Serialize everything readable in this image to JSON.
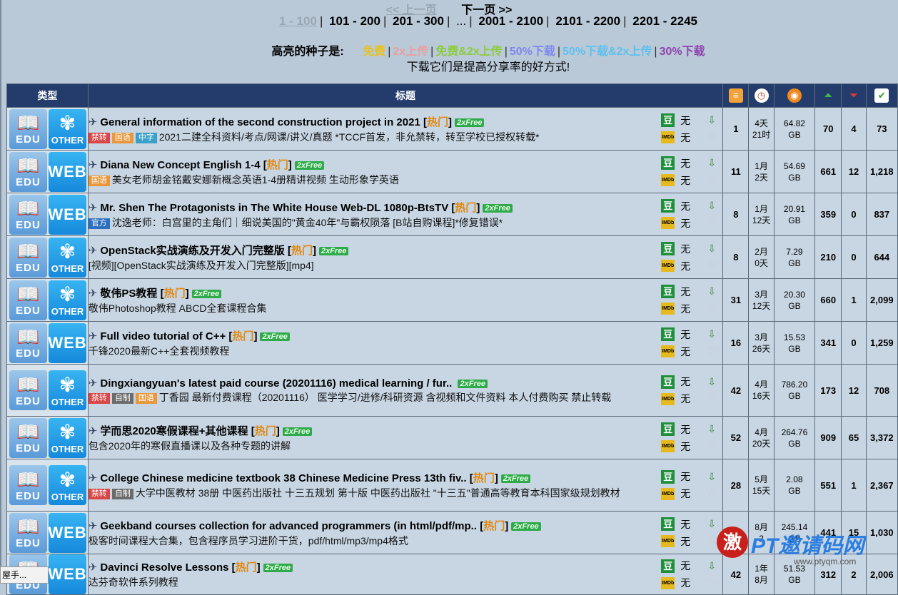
{
  "pager": {
    "prev": "<< 上一页",
    "next": "下一页 >>",
    "pages": [
      "1 - 100",
      "101 - 200",
      "201 - 300",
      "...",
      "2001 - 2100",
      "2101 - 2200",
      "2201 - 2245"
    ]
  },
  "legend": {
    "label": "高亮的种子是:",
    "items": [
      {
        "text": "免费",
        "color": "#e8c21a"
      },
      {
        "text": "2x上传",
        "color": "#e8a0a0"
      },
      {
        "text": "免费&2x上传",
        "color": "#8ccc3a"
      },
      {
        "text": "50%下载",
        "color": "#7f88ee"
      },
      {
        "text": "50%下载&2x上传",
        "color": "#5fc0ec"
      },
      {
        "text": "30%下载",
        "color": "#8e44ad"
      }
    ],
    "hint": "下载它们是提高分享率的好方式!"
  },
  "header": {
    "type": "类型",
    "title": "标题"
  },
  "rows": [
    {
      "cat": "OTHER",
      "title": "General information of the second construction project in 2021",
      "hot": "热门",
      "free": "2xFree",
      "tags": [
        {
          "t": "禁转",
          "c": "jz"
        },
        {
          "t": "国语",
          "c": "gy"
        },
        {
          "t": "中字",
          "c": "zw"
        }
      ],
      "sub": "2021二建全科资料/考点/网课/讲义/真题 *TCCF首发，非允禁转，转至学校已授权转载*",
      "douban": "无",
      "imdb": "无",
      "comments": "1",
      "time": [
        "4天",
        "21时"
      ],
      "size": [
        "64.82",
        "GB"
      ],
      "seeders": "70",
      "leechers": "4",
      "snatched": "73"
    },
    {
      "cat": "WEB",
      "title": "Diana New Concept English 1-4",
      "hot": "热门",
      "free": "2xFree",
      "tags": [
        {
          "t": "国语",
          "c": "gy"
        }
      ],
      "sub": "美女老师胡金铭戴安娜新概念英语1-4册精讲视频 生动形象学英语",
      "douban": "无",
      "imdb": "无",
      "comments": "11",
      "time": [
        "1月",
        "2天"
      ],
      "size": [
        "54.69",
        "GB"
      ],
      "seeders": "661",
      "leechers": "12",
      "snatched": "1,218"
    },
    {
      "cat": "WEB",
      "title": "Mr. Shen The Protagonists in The White House Web-DL 1080p-BtsTV",
      "hot": "热门",
      "free": "2xFree",
      "tags": [
        {
          "t": "官方",
          "c": "gf"
        }
      ],
      "sub": "沈逸老师：白宫里的主角们｜细说美国的\"黄金40年\"与霸权陨落 [B站自购课程]*修复错误*",
      "douban": "无",
      "imdb": "无",
      "comments": "8",
      "time": [
        "1月",
        "12天"
      ],
      "size": [
        "20.91",
        "GB"
      ],
      "seeders": "359",
      "leechers": "0",
      "snatched": "837"
    },
    {
      "cat": "OTHER",
      "title": "OpenStack实战演练及开发入门完整版",
      "hot": "热门",
      "free": "2xFree",
      "tags": [],
      "sub": "[视频][OpenStack实战演练及开发入门完整版][mp4]",
      "douban": "无",
      "imdb": "无",
      "comments": "8",
      "time": [
        "2月",
        "0天"
      ],
      "size": [
        "7.29",
        "GB"
      ],
      "seeders": "210",
      "leechers": "0",
      "snatched": "644"
    },
    {
      "cat": "OTHER",
      "title": "敬伟PS教程",
      "hot": "热门",
      "free": "2xFree",
      "tags": [],
      "sub": "敬伟Photoshop教程 ABCD全套课程合集",
      "douban": "无",
      "imdb": "无",
      "comments": "31",
      "time": [
        "3月",
        "12天"
      ],
      "size": [
        "20.30",
        "GB"
      ],
      "seeders": "660",
      "leechers": "1",
      "snatched": "2,099"
    },
    {
      "cat": "WEB",
      "title": "Full video tutorial of C++",
      "hot": "热门",
      "free": "2xFree",
      "tags": [],
      "sub": "千锋2020最新C++全套视频教程",
      "douban": "无",
      "imdb": "无",
      "comments": "16",
      "time": [
        "3月",
        "26天"
      ],
      "size": [
        "15.53",
        "GB"
      ],
      "seeders": "341",
      "leechers": "0",
      "snatched": "1,259"
    },
    {
      "cat": "OTHER",
      "title": "Dingxiangyuan's latest paid course (20201116) medical learning / fur..",
      "hot": "",
      "free": "2xFree",
      "tags": [
        {
          "t": "禁转",
          "c": "jz"
        },
        {
          "t": "自制",
          "c": "zz"
        },
        {
          "t": "国语",
          "c": "gy"
        }
      ],
      "sub": "丁香园 最新付费课程（20201116） 医学学习/进修/科研资源 含视频和文件资料 本人付费购买 禁止转载",
      "douban": "无",
      "imdb": "无",
      "comments": "42",
      "time": [
        "4月",
        "16天"
      ],
      "size": [
        "786.20",
        "GB"
      ],
      "seeders": "173",
      "leechers": "12",
      "snatched": "708"
    },
    {
      "cat": "OTHER",
      "title": "学而思2020寒假课程+其他课程",
      "hot": "热门",
      "free": "2xFree",
      "tags": [],
      "sub": "包含2020年的寒假直播课以及各种专题的讲解",
      "douban": "无",
      "imdb": "无",
      "comments": "52",
      "time": [
        "4月",
        "20天"
      ],
      "size": [
        "264.76",
        "GB"
      ],
      "seeders": "909",
      "leechers": "65",
      "snatched": "3,372"
    },
    {
      "cat": "OTHER",
      "title": "College Chinese medicine textbook 38 Chinese Medicine Press 13th fiv..",
      "hot": "热门",
      "free": "2xFree",
      "tags": [
        {
          "t": "禁转",
          "c": "jz"
        },
        {
          "t": "自制",
          "c": "zz"
        }
      ],
      "sub": "大学中医教材 38册 中医药出版社 十三五规划 第十版 中医药出版社 \"十三五\"普通高等教育本科国家级规划教材",
      "douban": "无",
      "imdb": "无",
      "comments": "28",
      "time": [
        "5月",
        "15天"
      ],
      "size": [
        "2.08",
        "GB"
      ],
      "seeders": "551",
      "leechers": "1",
      "snatched": "2,367"
    },
    {
      "cat": "WEB",
      "title": "Geekband courses collection for advanced programmers (in html/pdf/mp..",
      "hot": "热门",
      "free": "2xFree",
      "tags": [],
      "sub": "极客时间课程大合集，包含程序员学习进阶干货，pdf/html/mp3/mp4格式",
      "douban": "无",
      "imdb": "无",
      "comments": "15",
      "time": [
        "8月",
        "2"
      ],
      "size": [
        "245.14",
        "GB"
      ],
      "seeders": "441",
      "leechers": "15",
      "snatched": "1,030"
    },
    {
      "cat": "WEB",
      "title": "Davinci Resolve Lessons",
      "hot": "热门",
      "free": "2xFree",
      "tags": [],
      "sub": "达芬奇软件系列教程",
      "douban": "无",
      "imdb": "无",
      "comments": "42",
      "time": [
        "1年",
        "8月"
      ],
      "size": [
        "51.53",
        "GB"
      ],
      "seeders": "312",
      "leechers": "2",
      "snatched": "2,006"
    }
  ],
  "watermark": {
    "seal": "激",
    "text": "PT邀请码网",
    "url": "www.ptyqm.com"
  },
  "statusbar": "屋手..."
}
